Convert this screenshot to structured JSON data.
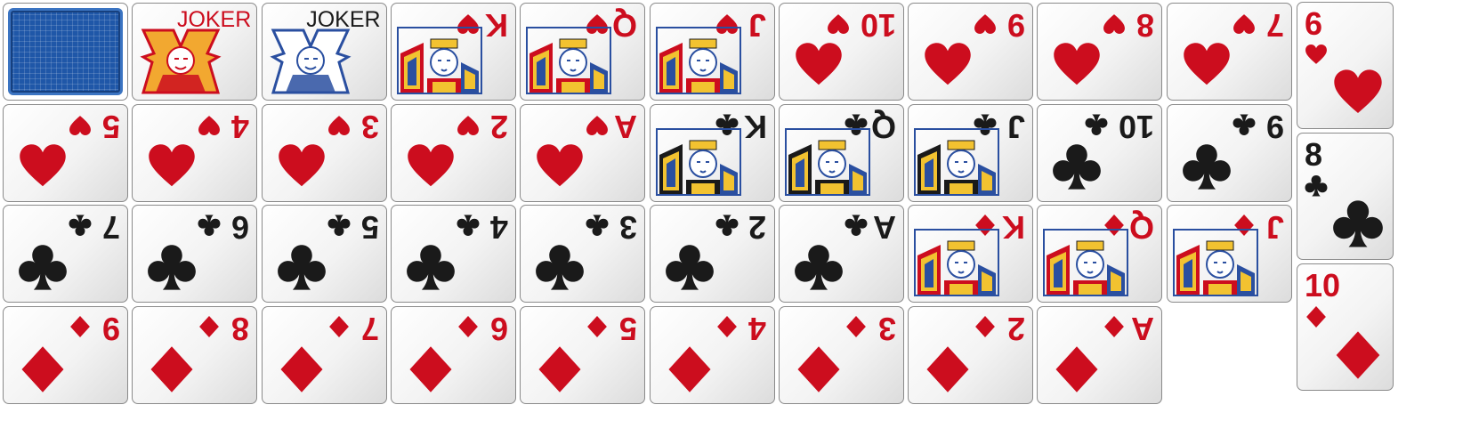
{
  "colors": {
    "red": "#cc0d1e",
    "black": "#1a1a1a",
    "back_blue": "#1f57a8"
  },
  "suit_icons": {
    "heart": "heart-icon",
    "diamond": "diamond-icon",
    "club": "club-icon",
    "spade": "spade-icon"
  },
  "grid_cards": [
    {
      "kind": "back"
    },
    {
      "kind": "joker",
      "label": "JOKER",
      "color": "red"
    },
    {
      "kind": "joker",
      "label": "JOKER",
      "color": "black"
    },
    {
      "kind": "card",
      "rank": "K",
      "suit": "heart",
      "face": true
    },
    {
      "kind": "card",
      "rank": "Q",
      "suit": "heart",
      "face": true
    },
    {
      "kind": "card",
      "rank": "J",
      "suit": "heart",
      "face": true
    },
    {
      "kind": "card",
      "rank": "10",
      "suit": "heart"
    },
    {
      "kind": "card",
      "rank": "9",
      "suit": "heart"
    },
    {
      "kind": "card",
      "rank": "8",
      "suit": "heart"
    },
    {
      "kind": "card",
      "rank": "7",
      "suit": "heart"
    },
    {
      "kind": "card",
      "rank": "5",
      "suit": "heart"
    },
    {
      "kind": "card",
      "rank": "4",
      "suit": "heart"
    },
    {
      "kind": "card",
      "rank": "3",
      "suit": "heart"
    },
    {
      "kind": "card",
      "rank": "2",
      "suit": "heart"
    },
    {
      "kind": "card",
      "rank": "A",
      "suit": "heart"
    },
    {
      "kind": "card",
      "rank": "K",
      "suit": "club",
      "face": true
    },
    {
      "kind": "card",
      "rank": "Q",
      "suit": "club",
      "face": true
    },
    {
      "kind": "card",
      "rank": "J",
      "suit": "club",
      "face": true
    },
    {
      "kind": "card",
      "rank": "10",
      "suit": "club"
    },
    {
      "kind": "card",
      "rank": "9",
      "suit": "club"
    },
    {
      "kind": "card",
      "rank": "7",
      "suit": "club"
    },
    {
      "kind": "card",
      "rank": "6",
      "suit": "club"
    },
    {
      "kind": "card",
      "rank": "5",
      "suit": "club"
    },
    {
      "kind": "card",
      "rank": "4",
      "suit": "club"
    },
    {
      "kind": "card",
      "rank": "3",
      "suit": "club"
    },
    {
      "kind": "card",
      "rank": "2",
      "suit": "club"
    },
    {
      "kind": "card",
      "rank": "A",
      "suit": "club"
    },
    {
      "kind": "card",
      "rank": "K",
      "suit": "diamond",
      "face": true
    },
    {
      "kind": "card",
      "rank": "Q",
      "suit": "diamond",
      "face": true
    },
    {
      "kind": "card",
      "rank": "J",
      "suit": "diamond",
      "face": true
    },
    {
      "kind": "card",
      "rank": "9",
      "suit": "diamond"
    },
    {
      "kind": "card",
      "rank": "8",
      "suit": "diamond"
    },
    {
      "kind": "card",
      "rank": "7",
      "suit": "diamond"
    },
    {
      "kind": "card",
      "rank": "6",
      "suit": "diamond"
    },
    {
      "kind": "card",
      "rank": "5",
      "suit": "diamond"
    },
    {
      "kind": "card",
      "rank": "4",
      "suit": "diamond"
    },
    {
      "kind": "card",
      "rank": "3",
      "suit": "diamond"
    },
    {
      "kind": "card",
      "rank": "2",
      "suit": "diamond"
    },
    {
      "kind": "card",
      "rank": "A",
      "suit": "diamond"
    }
  ],
  "side_cards": [
    {
      "kind": "card",
      "rank": "6",
      "suit": "heart"
    },
    {
      "kind": "card",
      "rank": "8",
      "suit": "club"
    },
    {
      "kind": "card",
      "rank": "10",
      "suit": "diamond"
    }
  ]
}
